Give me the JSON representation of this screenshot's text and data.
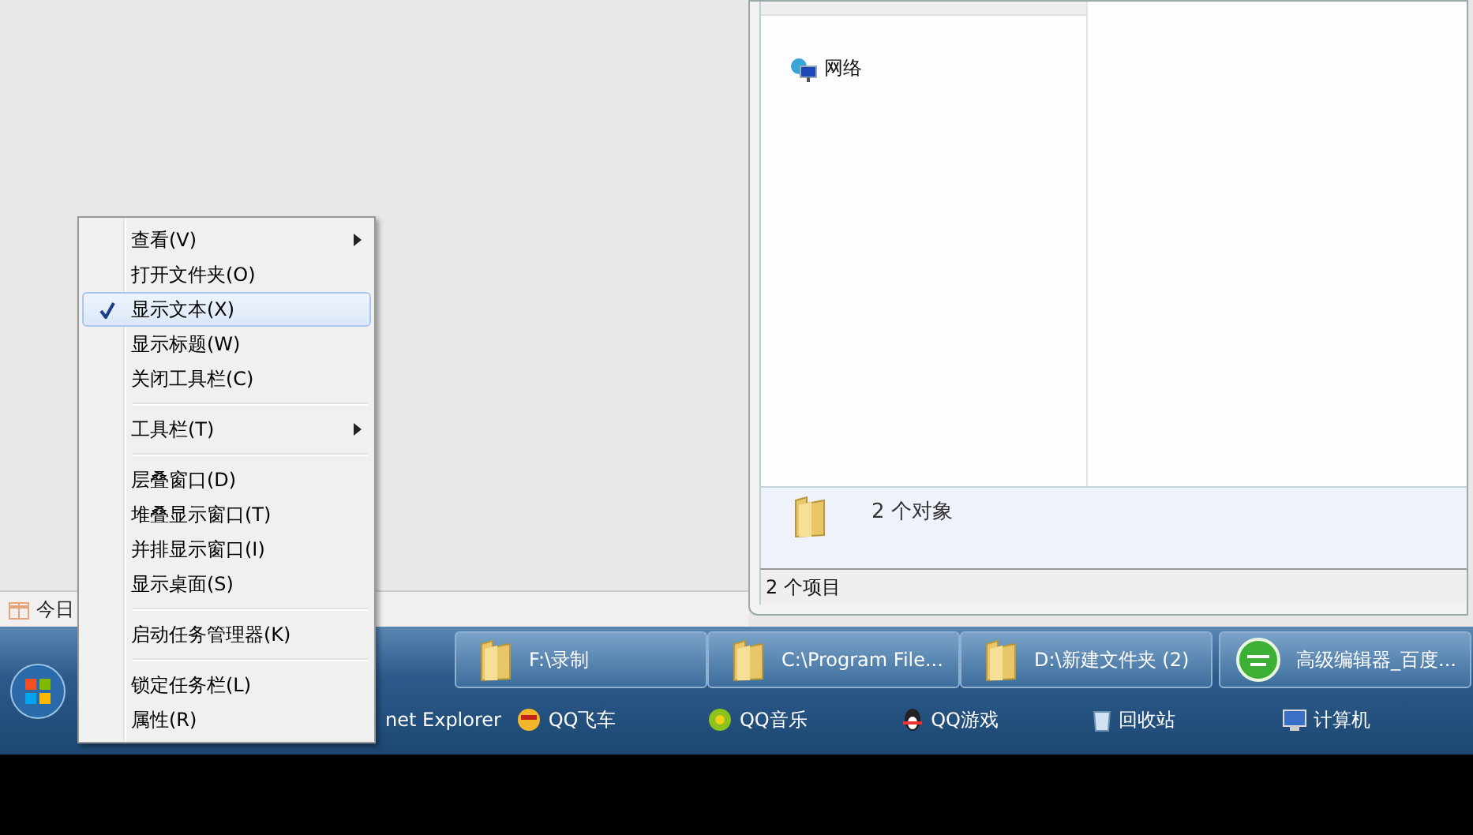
{
  "desktop_toolbar": {
    "label": "今日"
  },
  "explorer": {
    "nav_items": [
      {
        "label": "网络"
      }
    ],
    "details": {
      "summary": "2 个对象"
    },
    "status_bar": "2 个项目"
  },
  "taskbar": {
    "windows": [
      {
        "label": "F:\\录制",
        "kind": "folder"
      },
      {
        "label": "C:\\Program File...",
        "kind": "folder"
      },
      {
        "label": "D:\\新建文件夹 (2)",
        "kind": "folder"
      },
      {
        "label": "高级编辑器_百度...",
        "kind": "browser"
      }
    ],
    "quick_launch": [
      {
        "label": "net Explorer",
        "kind": "none"
      },
      {
        "label": "QQ飞车",
        "kind": "racer"
      },
      {
        "label": "QQ音乐",
        "kind": "music"
      },
      {
        "label": "QQ游戏",
        "kind": "penguin"
      },
      {
        "label": "回收站",
        "kind": "bin"
      },
      {
        "label": "计算机",
        "kind": "computer"
      }
    ]
  },
  "context_menu": {
    "items": [
      {
        "kind": "item",
        "label": "查看(V)",
        "submenu": true,
        "checked": false,
        "selected": false
      },
      {
        "kind": "item",
        "label": "打开文件夹(O)",
        "submenu": false,
        "checked": false,
        "selected": false
      },
      {
        "kind": "item",
        "label": "显示文本(X)",
        "submenu": false,
        "checked": true,
        "selected": true
      },
      {
        "kind": "item",
        "label": "显示标题(W)",
        "submenu": false,
        "checked": false,
        "selected": false
      },
      {
        "kind": "item",
        "label": "关闭工具栏(C)",
        "submenu": false,
        "checked": false,
        "selected": false
      },
      {
        "kind": "separator"
      },
      {
        "kind": "item",
        "label": "工具栏(T)",
        "submenu": true,
        "checked": false,
        "selected": false
      },
      {
        "kind": "separator"
      },
      {
        "kind": "item",
        "label": "层叠窗口(D)",
        "submenu": false,
        "checked": false,
        "selected": false
      },
      {
        "kind": "item",
        "label": "堆叠显示窗口(T)",
        "submenu": false,
        "checked": false,
        "selected": false
      },
      {
        "kind": "item",
        "label": "并排显示窗口(I)",
        "submenu": false,
        "checked": false,
        "selected": false
      },
      {
        "kind": "item",
        "label": "显示桌面(S)",
        "submenu": false,
        "checked": false,
        "selected": false
      },
      {
        "kind": "separator"
      },
      {
        "kind": "item",
        "label": "启动任务管理器(K)",
        "submenu": false,
        "checked": false,
        "selected": false
      },
      {
        "kind": "separator"
      },
      {
        "kind": "item",
        "label": "锁定任务栏(L)",
        "submenu": false,
        "checked": false,
        "selected": false
      },
      {
        "kind": "item",
        "label": "属性(R)",
        "submenu": false,
        "checked": false,
        "selected": false
      }
    ]
  }
}
